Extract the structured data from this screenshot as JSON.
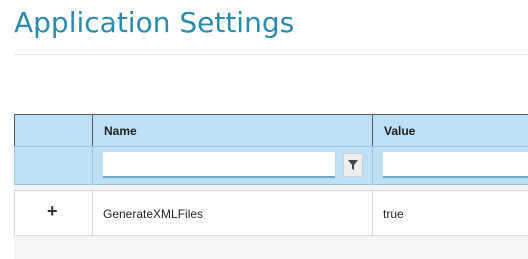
{
  "page": {
    "title": "Application Settings"
  },
  "grid": {
    "columns": [
      {
        "key": "expand",
        "label": ""
      },
      {
        "key": "name",
        "label": "Name"
      },
      {
        "key": "value",
        "label": "Value"
      }
    ],
    "filters": {
      "name": {
        "value": "",
        "placeholder": ""
      },
      "value": {
        "value": "",
        "placeholder": ""
      }
    },
    "rows": [
      {
        "expand_icon": "+",
        "name": "GenerateXMLFiles",
        "value": "true"
      }
    ]
  },
  "icons": {
    "filter": "funnel-icon",
    "expand": "plus-icon"
  },
  "colors": {
    "title": "#2a8bb0",
    "header_bg": "#bde0f5",
    "grid_bg": "#f5f5f5"
  }
}
